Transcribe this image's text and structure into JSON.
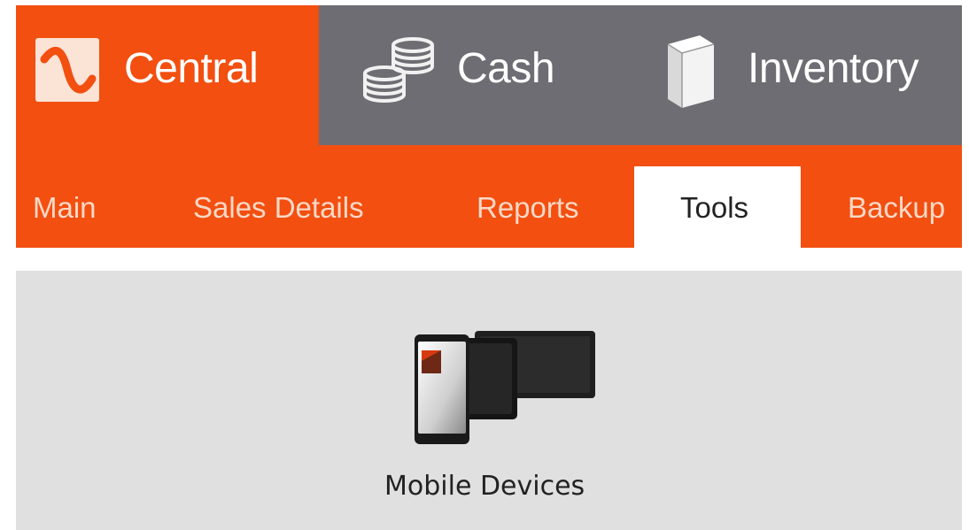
{
  "modules": {
    "central": {
      "label": "Central",
      "icon": "central-logo-icon",
      "active": true
    },
    "cash": {
      "label": "Cash",
      "icon": "coins-stack-icon",
      "active": false
    },
    "inventory": {
      "label": "Inventory",
      "icon": "box-icon",
      "active": false
    }
  },
  "subnav": {
    "tabs": [
      {
        "label": "Main",
        "active": false
      },
      {
        "label": "Sales Details",
        "active": false
      },
      {
        "label": "Reports",
        "active": false
      },
      {
        "label": "Tools",
        "active": true
      },
      {
        "label": "Backup",
        "active": false
      }
    ]
  },
  "tools": {
    "items": [
      {
        "label": "Mobile Devices",
        "icon": "mobile-devices-icon"
      }
    ]
  },
  "colors": {
    "accent": "#f24f10",
    "module_bar": "#6d6d73",
    "content_bg": "#e0e0e0",
    "tab_active_bg": "#ffffff"
  }
}
